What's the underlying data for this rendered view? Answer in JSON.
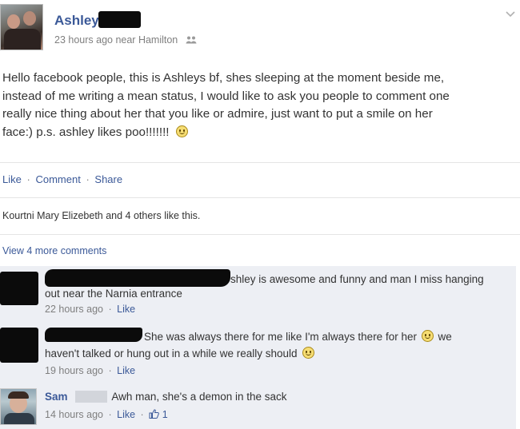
{
  "post": {
    "author_first_name": "Ashley",
    "meta": "23 hours ago near Hamilton",
    "body": "Hello facebook people, this is Ashleys bf, shes sleeping at the moment beside me, instead of me writing a mean status, I would like to ask you people to comment one really nice thing about her that you like or admire, just want to put a smile on her face:) p.s. ashley likes poo!!!!!!! ",
    "body_lines": [
      "Hello facebook people, this is Ashleys bf, shes sleeping at the moment beside me,",
      "instead of me writing a mean status, I would like to ask you people to comment one",
      "really nice thing about her that you like or admire, just want to put a smile on her",
      "face:) p.s. ashley likes poo!!!!!!!"
    ]
  },
  "actions": {
    "like": "Like",
    "comment": "Comment",
    "share": "Share",
    "sep": "·"
  },
  "likes_line": "Kourtni Mary Elizebeth and 4 others like this.",
  "view_more": "View 4 more comments",
  "comments": [
    {
      "text_line1": "shley is awesome and funny and man I miss hanging",
      "text_line2": "out near the Narnia entrance",
      "time": "22 hours ago",
      "like": "Like"
    },
    {
      "text_line1": "She was always there for me like I'm always there for her",
      "text_line1_tail": "we",
      "text_line2": "haven't talked or hung out in a while we really should",
      "time": "19 hours ago",
      "like": "Like"
    },
    {
      "author": "Sam",
      "text": "Awh man, she's a demon in the sack",
      "time": "14 hours ago",
      "like": "Like",
      "like_count": "1"
    }
  ],
  "icons": {
    "chevron": "chevron-down-icon",
    "people": "friends-icon",
    "smiley": "smiley-icon",
    "thumb": "thumbs-up-icon"
  },
  "colors": {
    "link": "#3b5998",
    "meta": "#7f7f7f",
    "comment_bg": "#edeff4",
    "text": "#333333"
  }
}
